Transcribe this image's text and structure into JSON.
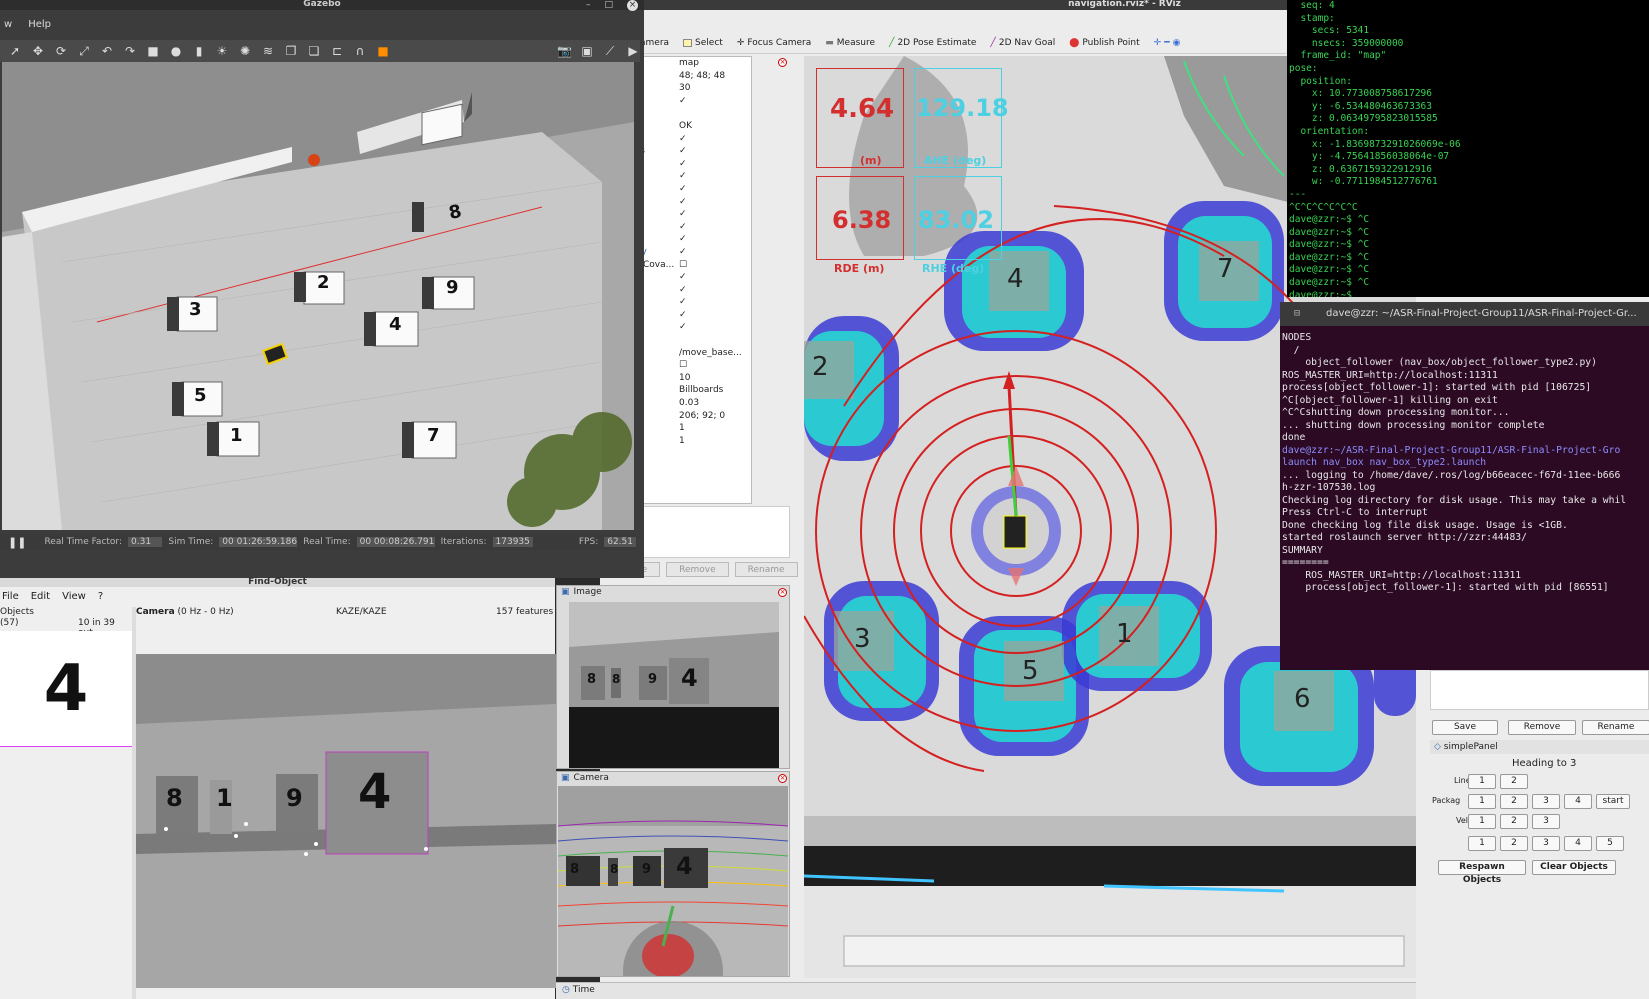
{
  "rviz": {
    "title": "navigation.rviz* - RViz",
    "toolbar": [
      {
        "label": "ve Camera"
      },
      {
        "label": "Select"
      },
      {
        "label": "Focus Camera"
      },
      {
        "label": "Measure"
      },
      {
        "label": "2D Pose Estimate"
      },
      {
        "label": "2D Nav Goal"
      },
      {
        "label": "Publish Point"
      }
    ],
    "displays": [
      {
        "name": "s",
        "value": "map"
      },
      {
        "name": "olor",
        "value": "48; 48; 48"
      },
      {
        "name": "",
        "value": "30"
      },
      {
        "name": "",
        "value": "✓"
      },
      {
        "name": "Ok",
        "value": ""
      },
      {
        "name": "e",
        "value": "OK"
      },
      {
        "name": "",
        "value": "✓"
      },
      {
        "name": "arkers",
        "value": "✓",
        "blue": true
      },
      {
        "name": "",
        "value": "✓"
      },
      {
        "name": "",
        "value": "✓"
      },
      {
        "name": "",
        "value": "✓"
      },
      {
        "name": "d2",
        "value": "✓",
        "blue": true
      },
      {
        "name": "",
        "value": "✓"
      },
      {
        "name": "",
        "value": "✓"
      },
      {
        "name": "",
        "value": "✓"
      },
      {
        "name": "eArray",
        "value": "✓",
        "blue": true
      },
      {
        "name": "eWithCova...",
        "value": "☐"
      },
      {
        "name": "",
        "value": "✓"
      },
      {
        "name": "",
        "value": "✓"
      },
      {
        "name": "",
        "value": "✓"
      },
      {
        "name": "",
        "value": "✓"
      },
      {
        "name": "",
        "value": "✓"
      },
      {
        "name": "Ok",
        "value": ""
      },
      {
        "name": "",
        "value": "/move_base..."
      },
      {
        "name": "",
        "value": "☐"
      },
      {
        "name": "",
        "value": "10"
      },
      {
        "name": "",
        "value": "Billboards"
      },
      {
        "name": "",
        "value": "0.03"
      },
      {
        "name": "",
        "value": "206; 92; 0"
      },
      {
        "name": "",
        "value": "1"
      },
      {
        "name": "ngth",
        "value": "1"
      }
    ],
    "display_buttons": {
      "add": "tate",
      "remove": "Remove",
      "rename": "Rename"
    },
    "metrics": [
      {
        "value": "4.64",
        "label": "(m)",
        "color": "#d32f2f"
      },
      {
        "value": "129.18",
        "label": "AHE (deg)",
        "color": "#4dd0e1"
      },
      {
        "value": "6.38",
        "label": "RDE (m)",
        "color": "#d32f2f"
      },
      {
        "value": "83.02",
        "label": "RHE (deg)",
        "color": "#4dd0e1"
      }
    ],
    "map_labels": [
      "4",
      "7",
      "2",
      "3",
      "5",
      "1",
      "6"
    ],
    "time_label": "Time"
  },
  "gazebo": {
    "title": "Gazebo",
    "menu": [
      "w",
      "Help"
    ],
    "scene_labels": [
      "8",
      "2",
      "9",
      "3",
      "4",
      "5",
      "1",
      "7"
    ],
    "status": {
      "rtf_label": "Real Time Factor:",
      "rtf": "0.31",
      "sim_label": "Sim Time:",
      "sim": "00 01:26:59.186",
      "real_label": "Real Time:",
      "real": "00 00:08:26.791",
      "iter_label": "Iterations:",
      "iter": "173935",
      "fps_label": "FPS:",
      "fps": "62.51"
    }
  },
  "find_object": {
    "title": "Find-Object",
    "menu": [
      "File",
      "Edit",
      "View",
      "?"
    ],
    "objects_label": "Objects",
    "count": "(57)",
    "inliers": "10 in 39 out",
    "object_glyph": "4",
    "camera_label": "Camera",
    "camera_rate": "(0 Hz - 0 Hz)",
    "detector": "KAZE/KAZE",
    "features": "157 features",
    "scene_labels": [
      "8",
      "1",
      "9",
      "4"
    ]
  },
  "image_panel": {
    "title": "Image",
    "labels": [
      "8",
      "8",
      "9",
      "4"
    ]
  },
  "camera_panel": {
    "title": "Camera",
    "labels": [
      "8",
      "8",
      "9",
      "4"
    ]
  },
  "terminal1": {
    "lines": [
      "  seq: 4",
      "  stamp:",
      "    secs: 5341",
      "    nsecs: 359000000",
      "  frame_id: \"map\"",
      "pose:",
      "  position:",
      "    x: 10.773008758617296",
      "    y: -6.534480463673363",
      "    z: 0.06349795823015585",
      "  orientation:",
      "    x: -1.8369873291026069e-06",
      "    y: -4.75641856038064e-07",
      "    z: 0.6367159322912916",
      "    w: -0.7711984512776761",
      "---",
      "^C^C^C^C^C^C",
      "dave@zzr:~$ ^C",
      "dave@zzr:~$ ^C",
      "dave@zzr:~$ ^C",
      "dave@zzr:~$ ^C",
      "dave@zzr:~$ ^C",
      "dave@zzr:~$ ^C",
      "dave@zzr:~$ "
    ]
  },
  "terminal2": {
    "title": "dave@zzr: ~/ASR-Final-Project-Group11/ASR-Final-Project-Gr...",
    "lines": [
      "NODES",
      "  /",
      "    object_follower (nav_box/object_follower_type2.py)",
      "",
      "ROS_MASTER_URI=http://localhost:11311",
      "",
      "process[object_follower-1]: started with pid [106725]",
      "^C[object_follower-1] killing on exit",
      "^C^Cshutting down processing monitor...",
      "... shutting down processing monitor complete",
      "done",
      "dave@zzr:~/ASR-Final-Project-Group11/ASR-Final-Project-Gro",
      "launch nav_box nav_box_type2.launch",
      "... logging to /home/dave/.ros/log/b66eacec-f67d-11ee-b666",
      "h-zzr-107530.log",
      "Checking log directory for disk usage. This may take a whil",
      "Press Ctrl-C to interrupt",
      "Done checking log file disk usage. Usage is <1GB.",
      "",
      "started roslaunch server http://zzr:44483/",
      "",
      "SUMMARY",
      "========",
      "    ROS_MASTER_URI=http://localhost:11311",
      "",
      "    process[object_follower-1]: started with pid [86551]"
    ]
  },
  "simple_panel": {
    "save": "Save",
    "remove": "Remove",
    "rename": "Rename",
    "title": "simplePanel",
    "heading": "Heading to 3",
    "line_label": "Line",
    "package_label": "Packag",
    "vel_label": "Vel",
    "line_btns": [
      "1",
      "2"
    ],
    "package_btns": [
      "1",
      "2",
      "3",
      "4",
      "start"
    ],
    "vel_btns": [
      "1",
      "2",
      "3"
    ],
    "extra_btns": [
      "1",
      "2",
      "3",
      "4",
      "5"
    ],
    "respawn": "Respawn Objects",
    "clear": "Clear Objects"
  }
}
